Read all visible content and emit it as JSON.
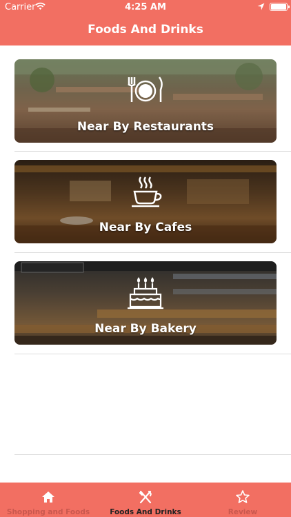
{
  "status_bar": {
    "carrier": "Carrier",
    "time": "4:25 AM"
  },
  "nav": {
    "title": "Foods And Drinks"
  },
  "categories": [
    {
      "label": "Near By Restaurants",
      "icon": "cutlery-plate-icon"
    },
    {
      "label": "Near By Cafes",
      "icon": "coffee-cup-icon"
    },
    {
      "label": "Near By Bakery",
      "icon": "birthday-cake-icon"
    }
  ],
  "tabs": [
    {
      "label": "Shopping and Foods",
      "icon": "home-icon",
      "selected": false
    },
    {
      "label": "Foods And Drinks",
      "icon": "cutlery-icon",
      "selected": true
    },
    {
      "label": "Review",
      "icon": "star-icon",
      "selected": false
    }
  ],
  "colors": {
    "accent": "#f26f62",
    "separator": "#dcdcdc",
    "active_tab_text": "#222222"
  }
}
